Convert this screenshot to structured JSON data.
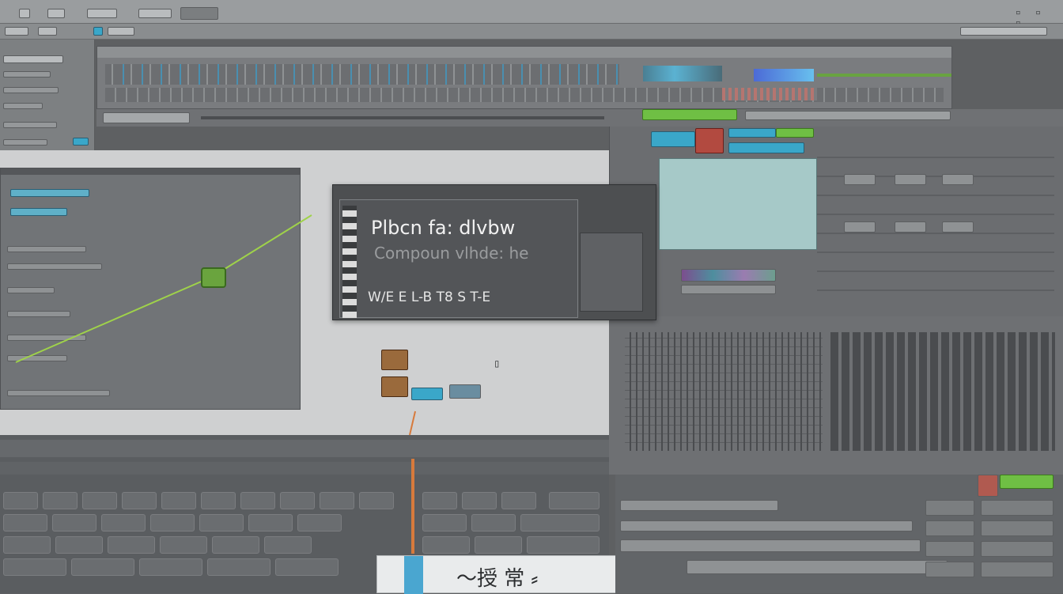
{
  "colors": {
    "accent_blue": "#3aa7c9",
    "accent_green": "#6fbf44",
    "accent_red": "#c0392b",
    "accent_orange": "#e07a2e",
    "panel_gray": "#8d9092",
    "dialog_dark": "#4d4f51"
  },
  "dialog": {
    "title": "Plbcn fa: dlvbw",
    "subtitle": "Compoun vlhde: he",
    "footer_text": "W/E E L-B T8 S T-E"
  },
  "bottom_popup": {
    "text": "〜授 常 ⸗"
  },
  "icons": {
    "top_left_square": "square-outline-icon",
    "window_controls": "window-controls-icon",
    "record_dot": "record-dot-icon",
    "node_target": "target-node-icon"
  }
}
